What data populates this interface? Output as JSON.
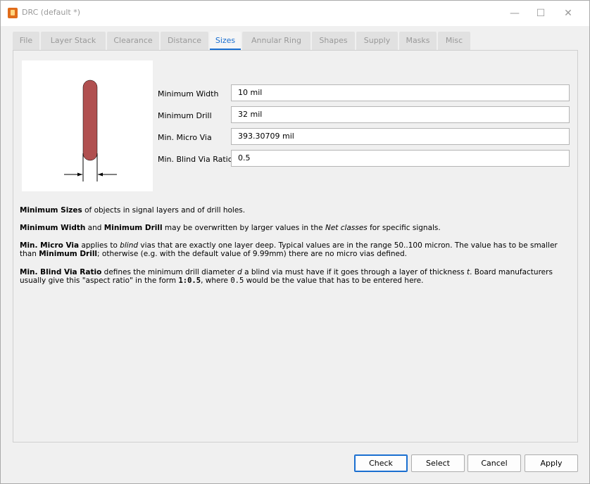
{
  "window": {
    "title": "DRC (default *)",
    "min": "—",
    "max": "☐",
    "close": "✕"
  },
  "tabs": [
    "File",
    "Layer Stack",
    "Clearance",
    "Distance",
    "Sizes",
    "Annular Ring",
    "Shapes",
    "Supply",
    "Masks",
    "Misc"
  ],
  "active_tab": "Sizes",
  "fields": [
    {
      "label": "Minimum Width",
      "value": "10 mil"
    },
    {
      "label": "Minimum Drill",
      "value": "32 mil"
    },
    {
      "label": "Min. Micro Via",
      "value": "393.30709 mil"
    },
    {
      "label": "Min. Blind Via Ratio",
      "value": "0.5"
    }
  ],
  "help": {
    "p1_b": "Minimum Sizes",
    "p1_t": " of objects in signal layers and of drill holes.",
    "p2_b1": "Minimum Width",
    "p2_t1": " and ",
    "p2_b2": "Minimum Drill",
    "p2_t2": " may be overwritten by larger values in the ",
    "p2_i": "Net classes",
    "p2_t3": " for specific signals.",
    "p3_b1": "Min. Micro Via",
    "p3_t1": " applies to ",
    "p3_i": "blind",
    "p3_t2": " vias that are exactly one layer deep. Typical values are in the range 50..100 micron. The value has to be smaller than ",
    "p3_b2": "Minimum Drill",
    "p3_t3": "; otherwise (e.g. with the default value of 9.99mm) there are no micro vias defined.",
    "p4_b": "Min. Blind Via Ratio",
    "p4_t1": " defines the minimum drill diameter ",
    "p4_i1": "d",
    "p4_t2": " a blind via must have if it goes through a layer of thickness ",
    "p4_i2": "t",
    "p4_t3": ". Board manufacturers usually give this \"aspect ratio\" in the form ",
    "p4_m1": "1:0.5",
    "p4_t4": ", where ",
    "p4_m2": "0.5",
    "p4_t5": " would be the value that has to be entered here."
  },
  "buttons": {
    "check": "Check",
    "select": "Select",
    "cancel": "Cancel",
    "apply": "Apply"
  },
  "colors": {
    "accent": "#1a6fd0",
    "trace": "#b05050"
  }
}
